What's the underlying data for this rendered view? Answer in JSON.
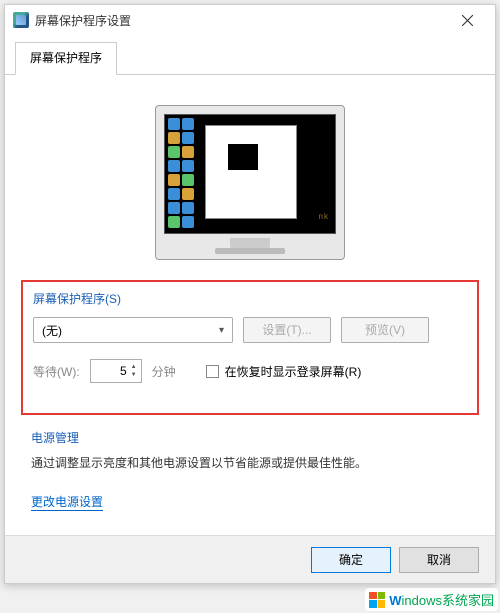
{
  "window": {
    "title": "屏幕保护程序设置"
  },
  "tab": {
    "label": "屏幕保护程序"
  },
  "screensaver": {
    "group_label": "屏幕保护程序(S)",
    "selected": "(无)",
    "settings_btn": "设置(T)...",
    "preview_btn": "预览(V)",
    "wait_label": "等待(W):",
    "wait_value": "5",
    "minutes_label": "分钟",
    "resume_checkbox": "在恢复时显示登录屏幕(R)"
  },
  "power": {
    "title": "电源管理",
    "description": "通过调整显示亮度和其他电源设置以节省能源或提供最佳性能。",
    "link": "更改电源设置"
  },
  "footer": {
    "ok": "确定",
    "cancel": "取消"
  },
  "watermark": {
    "brand_prefix": "W",
    "brand_rest": "indows系统家园"
  },
  "monitor_badge": "nk"
}
